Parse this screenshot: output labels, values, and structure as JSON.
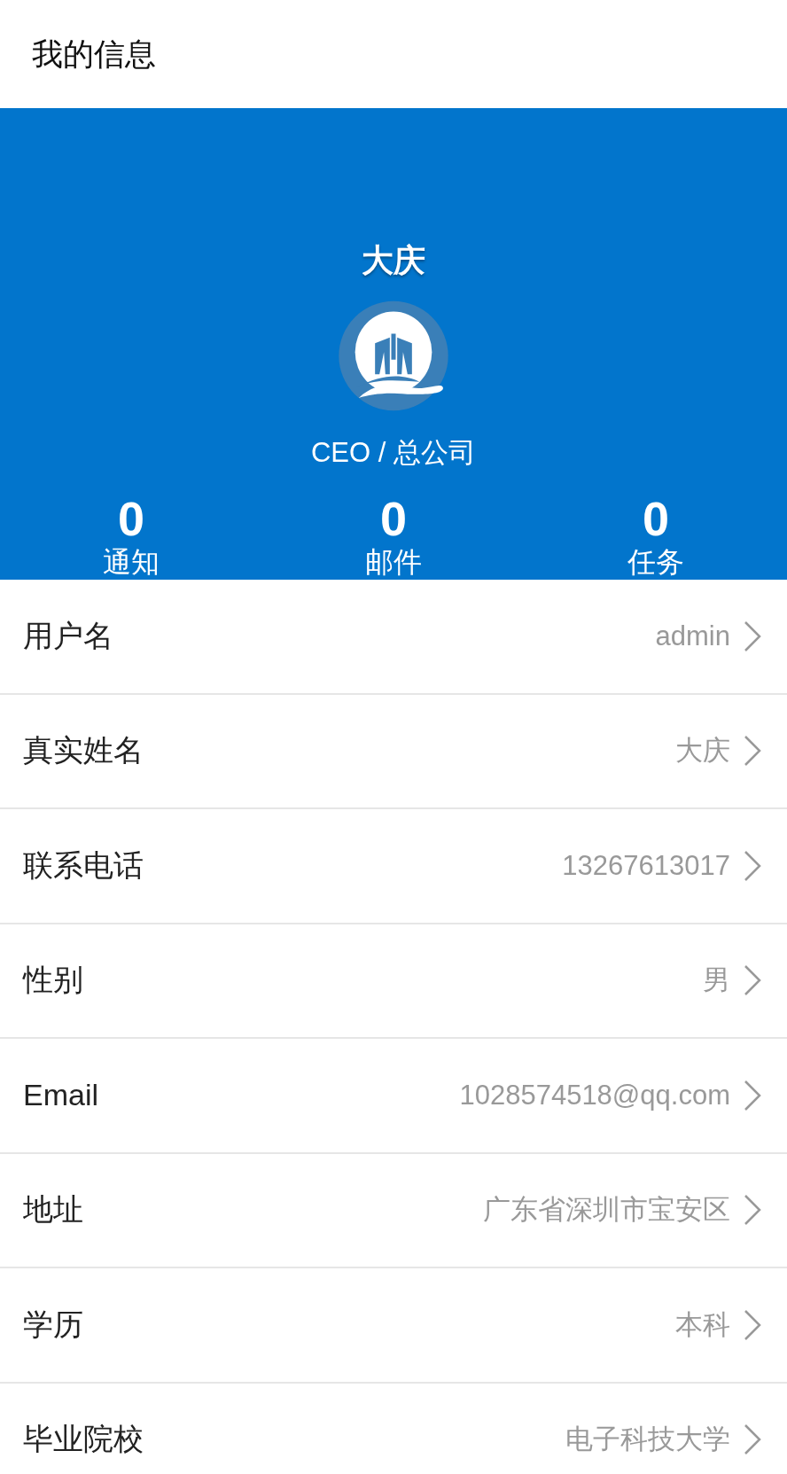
{
  "header": {
    "title": "我的信息"
  },
  "profile": {
    "name": "大庆",
    "role": "CEO / 总公司",
    "stats": [
      {
        "value": "0",
        "label": "通知"
      },
      {
        "value": "0",
        "label": "邮件"
      },
      {
        "value": "0",
        "label": "任务"
      }
    ]
  },
  "fields": [
    {
      "label": "用户名",
      "value": "admin"
    },
    {
      "label": "真实姓名",
      "value": "大庆"
    },
    {
      "label": "联系电话",
      "value": "13267613017"
    },
    {
      "label": "性别",
      "value": "男"
    },
    {
      "label": "Email",
      "value": "1028574518@qq.com"
    },
    {
      "label": "地址",
      "value": "广东省深圳市宝安区"
    },
    {
      "label": "学历",
      "value": "本科"
    },
    {
      "label": "毕业院校",
      "value": "电子科技大学"
    }
  ]
}
